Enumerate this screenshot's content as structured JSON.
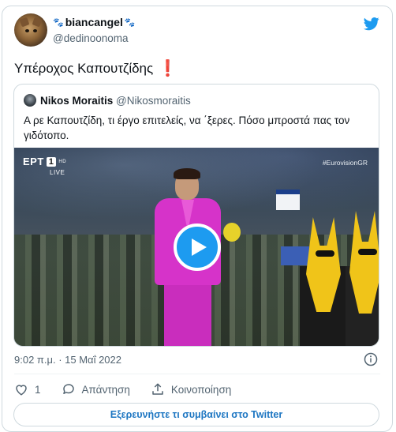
{
  "user": {
    "display_name": "biancangel",
    "handle": "@dedinoonoma",
    "paw_icon": "🐾"
  },
  "tweet": {
    "text": "Υπέροχος Καπουτζίδης",
    "emoji": "❗"
  },
  "quoted_tweet": {
    "name": "Nikos Moraitis",
    "handle": "@Nikosmoraitis",
    "text": "Α ρε Καπουτζίδη, τι έργο επιτελείς, να ΄ξερες. Πόσο μπροστά πας τον γιδότοπο.",
    "video": {
      "channel": "ΕΡΤ",
      "channel_num": "1",
      "hd": "HD",
      "live": "LIVE",
      "hashtag": "#EurovisionGR"
    }
  },
  "meta": {
    "timestamp": "9:02 π.μ. · 15 Μαΐ 2022"
  },
  "actions": {
    "like_count": "1",
    "reply_label": "Απάντηση",
    "share_label": "Κοινοποίηση"
  },
  "explore_label": "Εξερευνήστε τι συμβαίνει στο Twitter",
  "colors": {
    "accent": "#1d9bf0",
    "link": "#1d76c2",
    "secondary_text": "#536471",
    "exclaim": "#e0245e",
    "suit": "#d633c9"
  }
}
